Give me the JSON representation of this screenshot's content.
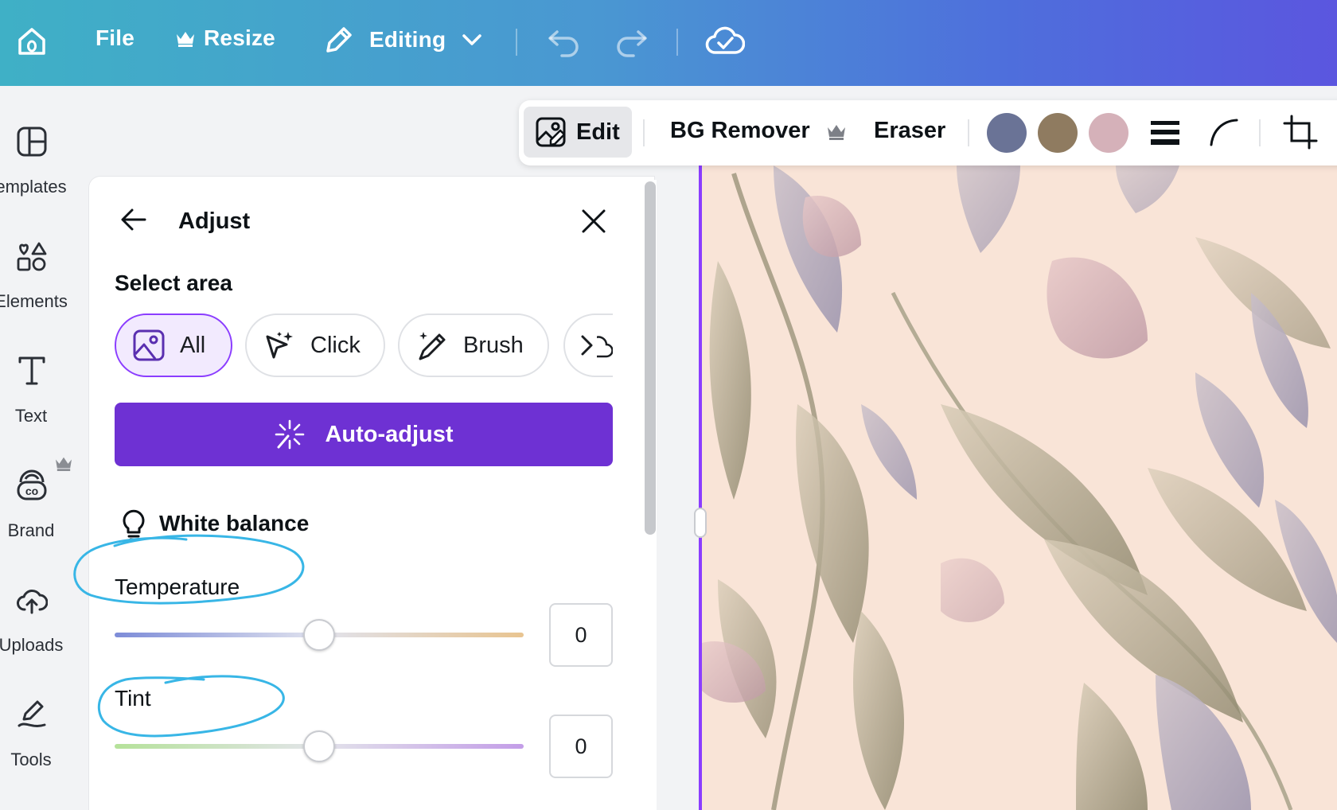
{
  "topbar": {
    "file_label": "File",
    "resize_label": "Resize",
    "editing_label": "Editing"
  },
  "rail": {
    "items": [
      {
        "label": "emplates",
        "icon": "templates-icon"
      },
      {
        "label": "Elements",
        "icon": "elements-icon"
      },
      {
        "label": "Text",
        "icon": "text-icon"
      },
      {
        "label": "Brand",
        "icon": "brand-icon"
      },
      {
        "label": "Uploads",
        "icon": "uploads-icon"
      },
      {
        "label": "Tools",
        "icon": "tools-icon"
      }
    ]
  },
  "toolbar": {
    "edit_label": "Edit",
    "bg_remover_label": "BG Remover",
    "eraser_label": "Eraser",
    "swatches": [
      "#6a7396",
      "#8f7b60",
      "#d5b1b9"
    ]
  },
  "panel": {
    "title": "Adjust",
    "select_area_label": "Select area",
    "chips": [
      "All",
      "Click",
      "Brush"
    ],
    "auto_adjust_label": "Auto-adjust",
    "white_balance_label": "White balance",
    "temperature": {
      "label": "Temperature",
      "value": "0"
    },
    "tint": {
      "label": "Tint",
      "value": "0"
    }
  },
  "colors": {
    "accent": "#8b3dff",
    "auto_adjust_bg": "#6e31d3",
    "annotation": "#38b6e6"
  }
}
